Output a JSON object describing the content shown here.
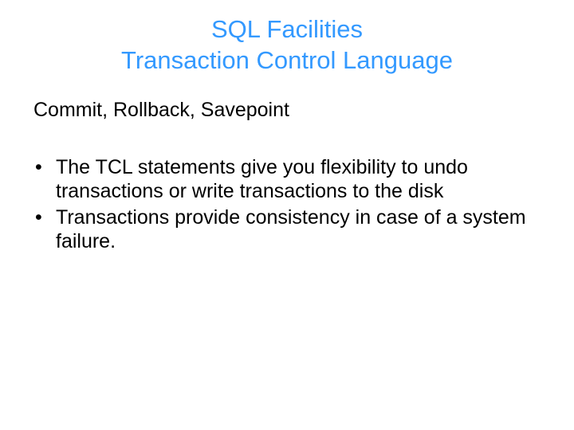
{
  "title": {
    "line1": "SQL Facilities",
    "line2": "Transaction Control Language"
  },
  "subtitle": "Commit, Rollback, Savepoint",
  "bullets": [
    "The TCL statements give you flexibility to undo transactions or write transactions to the disk",
    "Transactions provide consistency in case of a system failure."
  ]
}
